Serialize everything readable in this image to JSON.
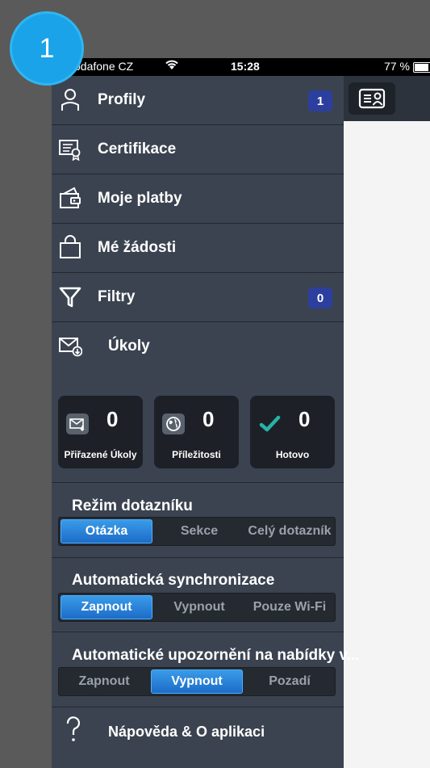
{
  "step_badge": "1",
  "status_bar": {
    "carrier": "odafone CZ",
    "time": "15:28",
    "battery": "77 %",
    "battery_level": 0.77
  },
  "menu": {
    "profiles": {
      "label": "Profily",
      "count": "1"
    },
    "certificates": {
      "label": "Certifikace"
    },
    "payments": {
      "label": "Moje platby"
    },
    "requests": {
      "label": "Mé žádosti"
    },
    "filters": {
      "label": "Filtry",
      "count": "0"
    },
    "tasks": {
      "label": "Úkoly"
    },
    "help": {
      "label": "Nápověda & O aplikaci"
    }
  },
  "task_tiles": [
    {
      "value": "0",
      "label": "Přiřazené Úkoly",
      "icon": "inbox-task-icon"
    },
    {
      "value": "0",
      "label": "Příležitosti",
      "icon": "globe-icon"
    },
    {
      "value": "0",
      "label": "Hotovo",
      "icon": "checkmark-icon"
    }
  ],
  "questionnaire_mode": {
    "title": "Režim dotazníku",
    "options": [
      "Otázka",
      "Sekce",
      "Celý dotazník"
    ],
    "selected": "Otázka"
  },
  "auto_sync": {
    "title": "Automatická synchronizace",
    "options": [
      "Zapnout",
      "Vypnout",
      "Pouze Wi-Fi"
    ],
    "selected": "Zapnout"
  },
  "auto_notify": {
    "title": "Automatické upozornění na nabídky v...",
    "options": [
      "Zapnout",
      "Vypnout",
      "Pozadí"
    ],
    "selected": "Vypnout"
  },
  "colors": {
    "menu_bg": "#3b4350",
    "accent_blue": "#1c6cc8",
    "badge_blue": "#2c3f9e",
    "step_badge": "#1aa3e8",
    "check_teal": "#27b3a7"
  }
}
